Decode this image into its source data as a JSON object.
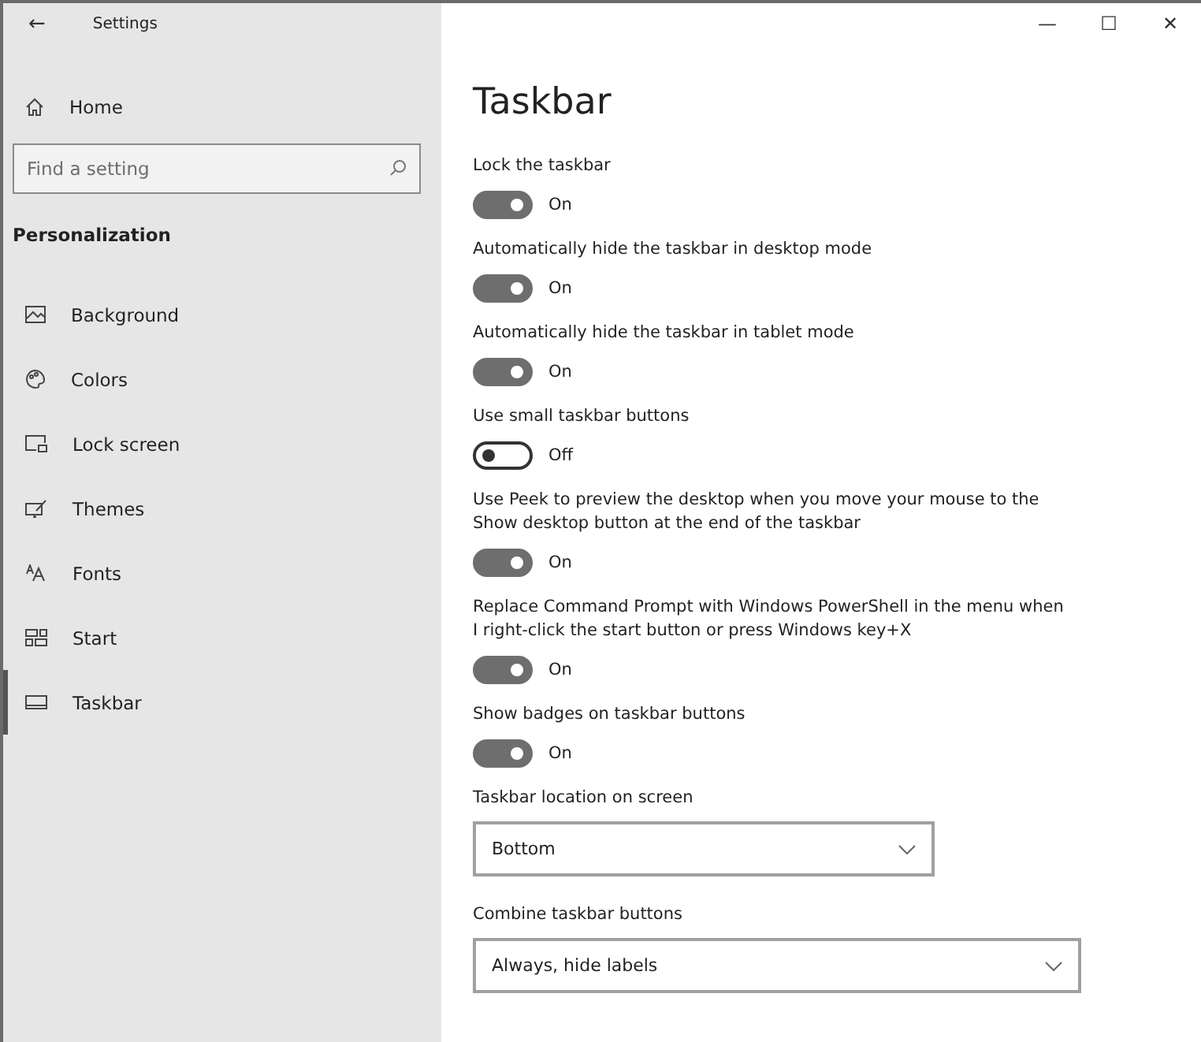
{
  "window": {
    "title": "Settings",
    "back": "←",
    "controls": [
      "—",
      "☐",
      "✕"
    ]
  },
  "sidebar": {
    "home": "Home",
    "search": {
      "placeholder": "Find a setting"
    },
    "section": "Personalization",
    "items": [
      {
        "label": "Background",
        "selected": false
      },
      {
        "label": "Colors",
        "selected": false
      },
      {
        "label": "Lock screen",
        "selected": false
      },
      {
        "label": "Themes",
        "selected": false
      },
      {
        "label": "Fonts",
        "selected": false
      },
      {
        "label": "Start",
        "selected": false
      },
      {
        "label": "Taskbar",
        "selected": true
      }
    ]
  },
  "page": {
    "title": "Taskbar",
    "settings": [
      {
        "kind": "toggle",
        "label": "Lock the taskbar",
        "on": true,
        "state": "On"
      },
      {
        "kind": "toggle",
        "label": "Automatically hide the taskbar in desktop mode",
        "on": true,
        "state": "On"
      },
      {
        "kind": "toggle",
        "label": "Automatically hide the taskbar in tablet mode",
        "on": true,
        "state": "On"
      },
      {
        "kind": "toggle",
        "label": "Use small taskbar buttons",
        "on": false,
        "state": "Off"
      },
      {
        "kind": "toggle",
        "label": "Use Peek to preview the desktop when you move your mouse to the Show desktop button at the end of the taskbar",
        "on": true,
        "state": "On"
      },
      {
        "kind": "toggle",
        "label": "Replace Command Prompt with Windows PowerShell in the menu when I right-click the start button or press Windows key+X",
        "on": true,
        "state": "On"
      },
      {
        "kind": "toggle",
        "label": "Show badges on taskbar buttons",
        "on": true,
        "state": "On"
      },
      {
        "kind": "dropdown",
        "label": "Taskbar location on screen",
        "value": "Bottom"
      },
      {
        "kind": "dropdown",
        "label": "Combine taskbar buttons",
        "value": "Always, hide labels"
      }
    ]
  }
}
